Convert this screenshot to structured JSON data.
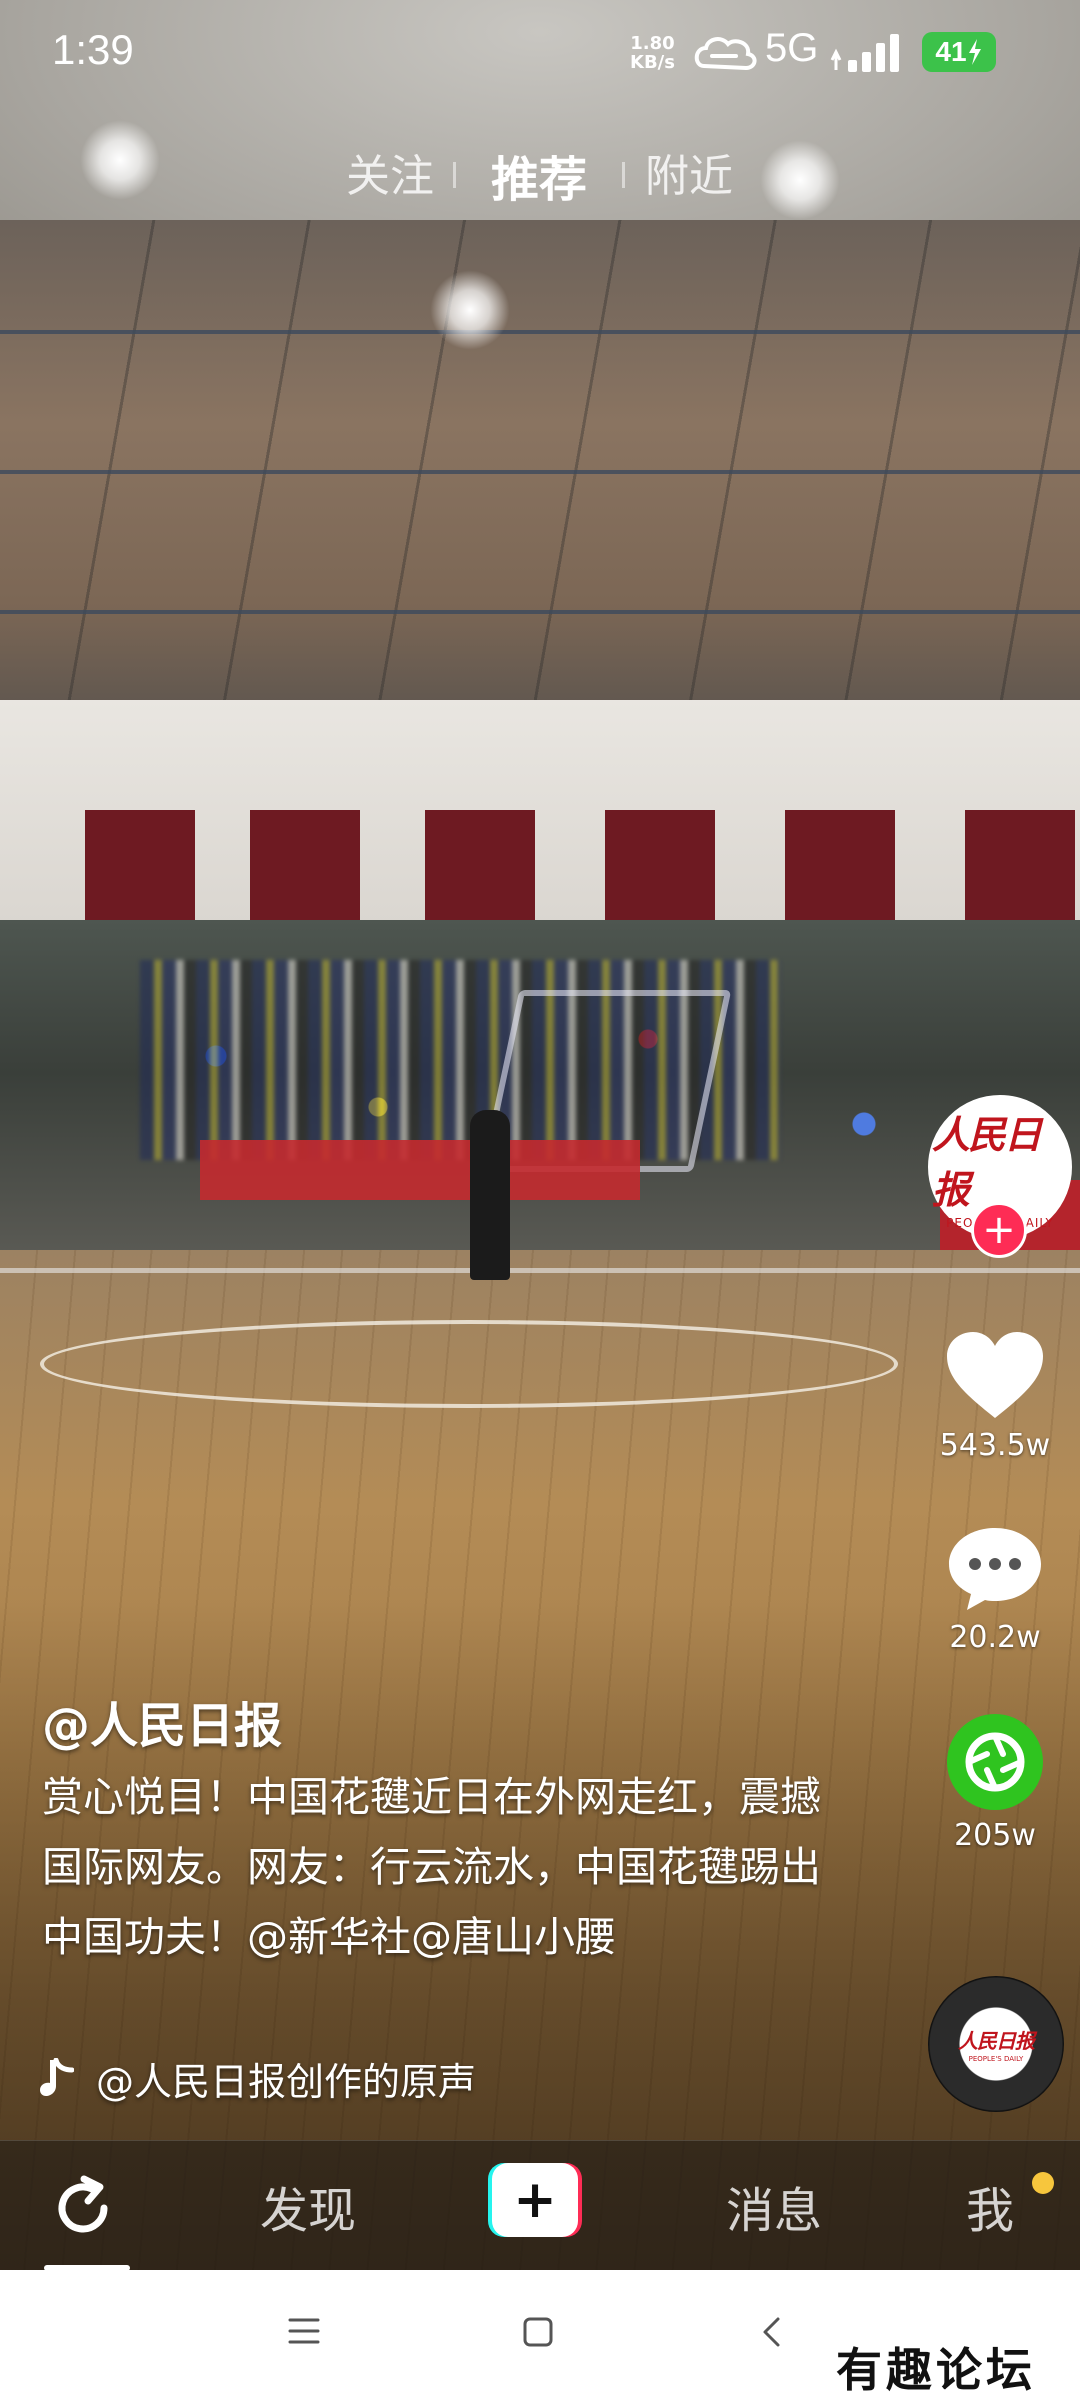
{
  "status_bar": {
    "time": "1:39",
    "net_speed_value": "1.80",
    "net_speed_unit": "KB/s",
    "network": "5G",
    "battery": "41"
  },
  "top_tabs": [
    {
      "label": "关注",
      "active": false
    },
    {
      "label": "推荐",
      "active": true
    },
    {
      "label": "附近",
      "active": false
    }
  ],
  "creator": {
    "avatar_logo_cn": "人民日报",
    "avatar_logo_en": "PEOPLE'S DAILY",
    "follow_symbol": "+"
  },
  "actions": {
    "likes": "543.5w",
    "comments": "20.2w",
    "shares": "205w"
  },
  "caption": {
    "author": "@人民日报",
    "description": "赏心悦目！中国花毽近日在外网走红，震撼国际网友。网友：行云流水，中国花毽踢出中国功夫！@新华社@唐山小腰",
    "music": "@人民日报创作的原声"
  },
  "bottom_nav": {
    "discover": "发现",
    "create": "+",
    "messages": "消息",
    "me": "我"
  },
  "watermark": "有趣论坛",
  "colors": {
    "accent_red": "#fe2c55",
    "accent_cyan": "#25f4ee",
    "share_green": "#2fc41f",
    "battery_green": "#3cc24a",
    "notification_dot": "#f7c63d"
  }
}
